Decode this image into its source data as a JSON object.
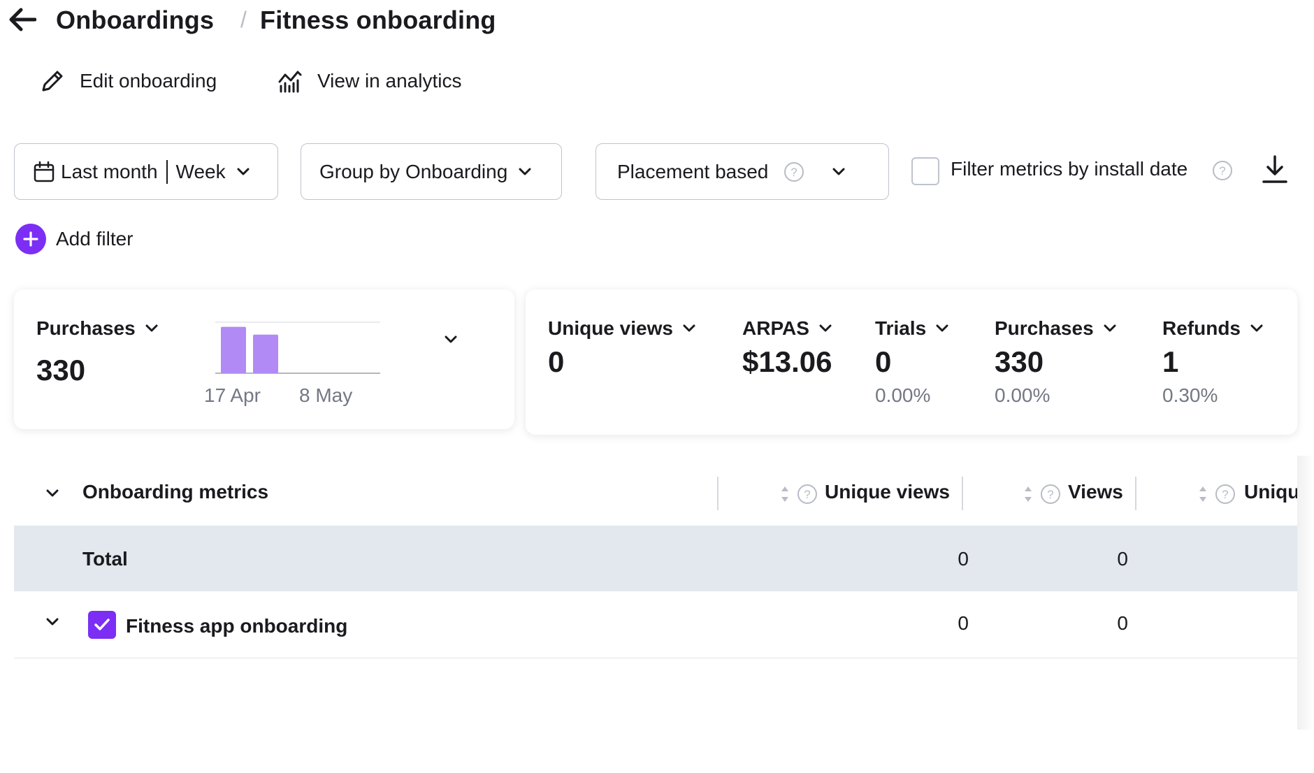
{
  "header": {
    "breadcrumb_parent": "Onboardings",
    "separator": "/",
    "breadcrumb_current": "Fitness onboarding",
    "back_icon": "arrow-left-icon"
  },
  "actions": {
    "edit_label": "Edit onboarding",
    "edit_icon": "pencil-icon",
    "analytics_label": "View in analytics",
    "analytics_icon": "analytics-chart-icon"
  },
  "filters": {
    "date_range": "Last month",
    "date_granularity": "Week",
    "group_by": "Group by Onboarding",
    "placement": "Placement based",
    "install_date_label": "Filter metrics by install date",
    "install_date_checked": false,
    "add_filter_label": "Add filter"
  },
  "summary_card": {
    "metric_label": "Purchases",
    "metric_value": "330",
    "chart_data": {
      "type": "bar",
      "categories": [
        "17 Apr",
        "8 May"
      ],
      "values": [
        180,
        150
      ],
      "xlabel": "",
      "ylabel": ""
    }
  },
  "metrics": [
    {
      "label": "Unique views",
      "value": "0",
      "sub": ""
    },
    {
      "label": "ARPAS",
      "value": "$13.06",
      "sub": ""
    },
    {
      "label": "Trials",
      "value": "0",
      "sub": "0.00%"
    },
    {
      "label": "Purchases",
      "value": "330",
      "sub": "0.00%"
    },
    {
      "label": "Refunds",
      "value": "1",
      "sub": "0.30%"
    }
  ],
  "table": {
    "section_title": "Onboarding metrics",
    "columns": [
      "Unique views",
      "Views",
      "Uniqu"
    ],
    "total_row": {
      "label": "Total",
      "values": [
        "0",
        "0"
      ]
    },
    "rows": [
      {
        "label": "Fitness app onboarding",
        "checked": true,
        "values": [
          "0",
          "0"
        ]
      }
    ]
  },
  "colors": {
    "accent": "#7c2ef4",
    "bar": "#b18af5",
    "total_row_bg": "#e3e7ee",
    "border": "#bfc3cc"
  }
}
